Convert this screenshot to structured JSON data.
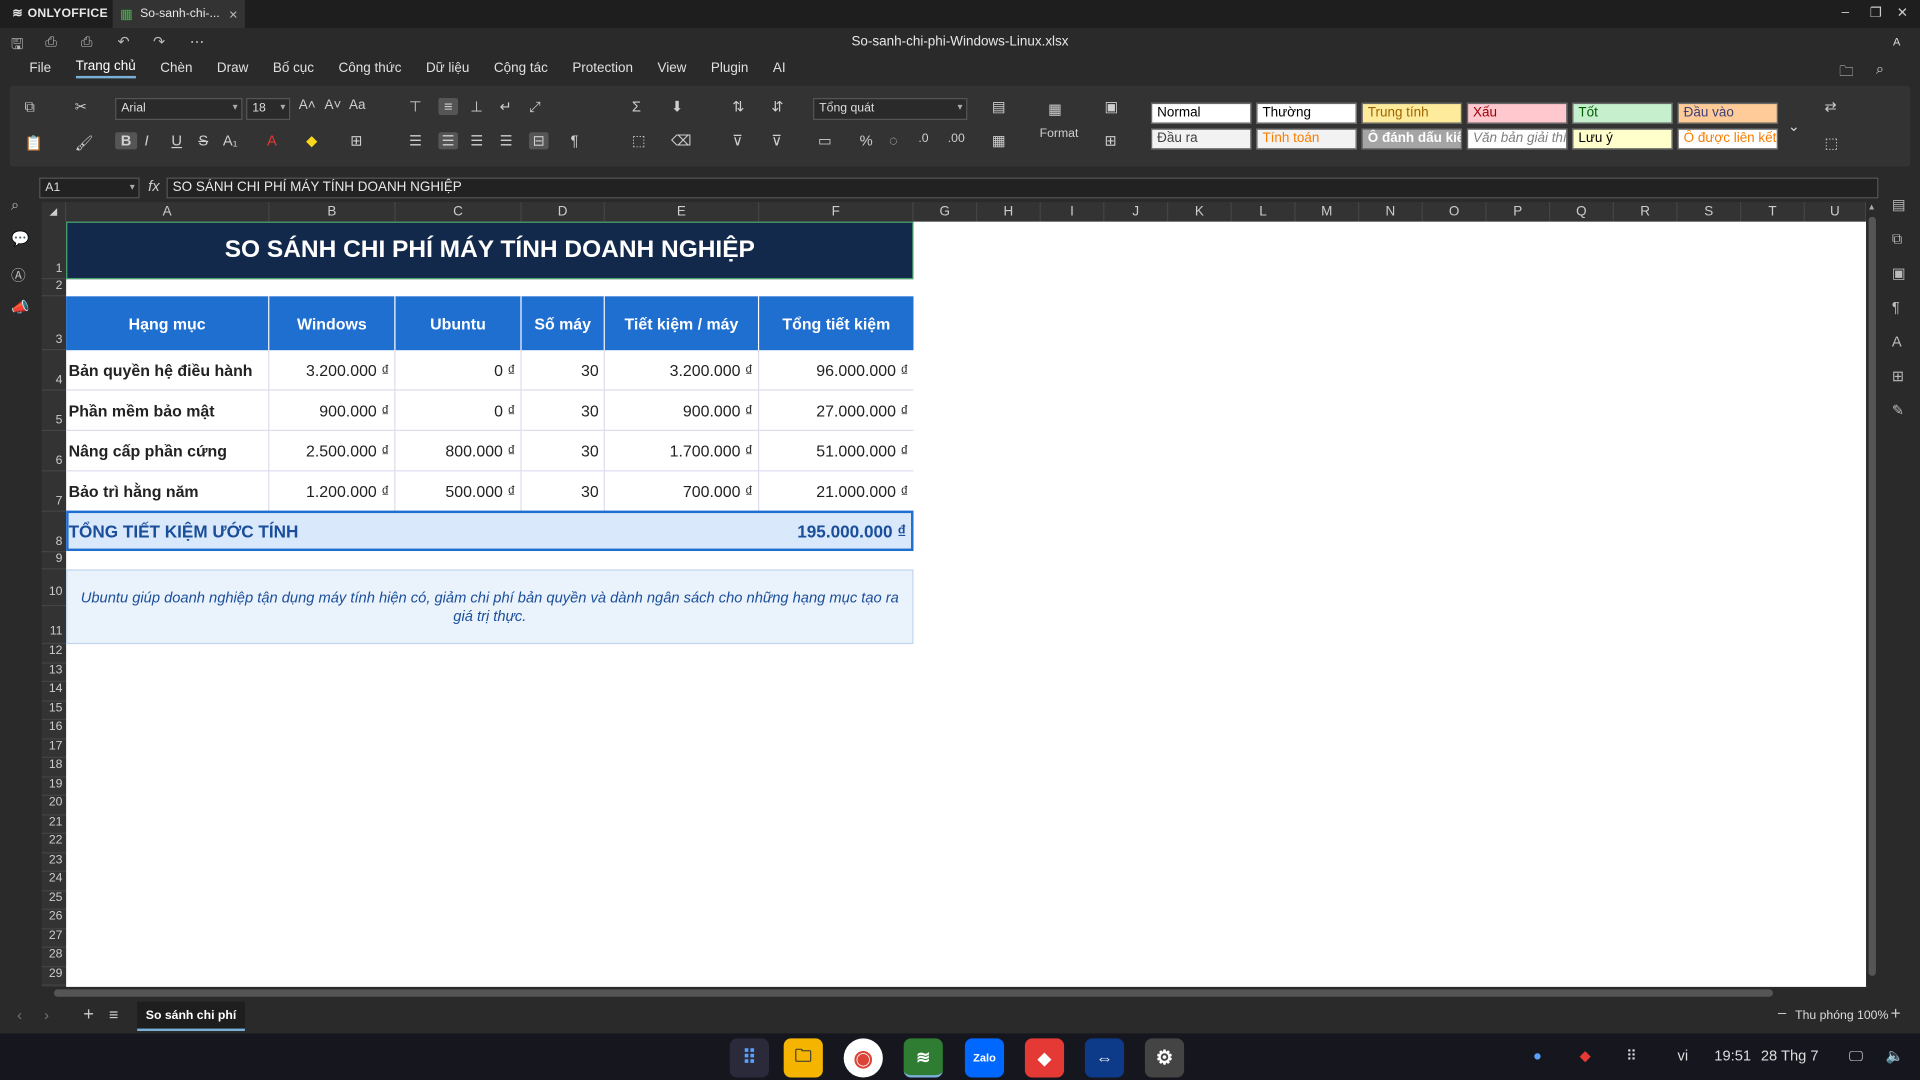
{
  "app": {
    "brand": "ONLYOFFICE",
    "tab_title": "So-sanh-chi-...",
    "file_name": "So-sanh-chi-phi-Windows-Linux.xlsx",
    "user_initial": "A"
  },
  "menu": [
    "File",
    "Trang chủ",
    "Chèn",
    "Draw",
    "Bố cục",
    "Công thức",
    "Dữ liệu",
    "Cộng tác",
    "Protection",
    "View",
    "Plugin",
    "AI"
  ],
  "menu_active": "Trang chủ",
  "ribbon": {
    "font_name": "Arial",
    "font_size": "18",
    "number_format": "Tổng quát",
    "format_label": "Format",
    "styles": [
      {
        "label": "Normal",
        "bg": "#ffffff",
        "fg": "#000000"
      },
      {
        "label": "Thường",
        "bg": "#ffffff",
        "fg": "#000000"
      },
      {
        "label": "Trung tính",
        "bg": "#ffeb9c",
        "fg": "#9c6500"
      },
      {
        "label": "Xấu",
        "bg": "#ffc7ce",
        "fg": "#9c0006"
      },
      {
        "label": "Tốt",
        "bg": "#c6efce",
        "fg": "#006100"
      },
      {
        "label": "Đầu vào",
        "bg": "#ffcc99",
        "fg": "#3f3f76"
      },
      {
        "label": "Đầu ra",
        "bg": "#f2f2f2",
        "fg": "#3f3f3f"
      },
      {
        "label": "Tính toán",
        "bg": "#f2f2f2",
        "fg": "#fa7d00"
      },
      {
        "label": "Ô đánh dấu kiể",
        "bg": "#a5a5a5",
        "fg": "#ffffff"
      },
      {
        "label": "Văn bản giải thí",
        "bg": "#ffffff",
        "fg": "#7f7f7f"
      },
      {
        "label": "Lưu ý",
        "bg": "#ffffcc",
        "fg": "#000000"
      },
      {
        "label": "Ô được liên kết",
        "bg": "#ffffff",
        "fg": "#fa7d00"
      }
    ]
  },
  "formula_bar": {
    "cell_ref": "A1",
    "fx": "fx",
    "content": "SO SÁNH CHI PHÍ MÁY TÍNH DOANH NGHIỆP"
  },
  "columns": [
    "A",
    "B",
    "C",
    "D",
    "E",
    "F",
    "G",
    "H",
    "I",
    "J",
    "K",
    "L",
    "M",
    "N",
    "O",
    "P",
    "Q",
    "R",
    "S",
    "T",
    "U"
  ],
  "rows": [
    "1",
    "2",
    "3",
    "4",
    "5",
    "6",
    "7",
    "8",
    "9",
    "10",
    "11",
    "12",
    "13",
    "14",
    "15",
    "16",
    "17",
    "18",
    "19",
    "20",
    "21",
    "22",
    "23",
    "24",
    "25",
    "26",
    "27",
    "28",
    "29"
  ],
  "sheet": {
    "title": "SO SÁNH CHI PHÍ MÁY TÍNH DOANH NGHIỆP",
    "headers": [
      "Hạng mục",
      "Windows",
      "Ubuntu",
      "Số máy",
      "Tiết kiệm / máy",
      "Tổng tiết kiệm"
    ],
    "rows": [
      [
        "Bản quyền hệ điều hành",
        "3.200.000 ₫",
        "0 ₫",
        "30",
        "3.200.000 ₫",
        "96.000.000 ₫"
      ],
      [
        "Phần mềm bảo mật",
        "900.000 ₫",
        "0 ₫",
        "30",
        "900.000 ₫",
        "27.000.000 ₫"
      ],
      [
        "Nâng cấp phần cứng",
        "2.500.000 ₫",
        "800.000 ₫",
        "30",
        "1.700.000 ₫",
        "51.000.000 ₫"
      ],
      [
        "Bảo trì hằng năm",
        "1.200.000 ₫",
        "500.000 ₫",
        "30",
        "700.000 ₫",
        "21.000.000 ₫"
      ]
    ],
    "total_label": "TỔNG TIẾT KIỆM ƯỚC TÍNH",
    "total_value": "195.000.000 ₫",
    "note": "Ubuntu giúp doanh nghiệp tận dụng máy tính hiện có, giảm chi phí bản quyền và dành ngân sách cho những hạng mục tạo ra giá trị thực.",
    "colors": {
      "title_bg": "#13294b",
      "header_bg": "#1f6fd1",
      "total_bg": "#d9e8fb",
      "total_fg": "#1a4e9a",
      "note_bg": "#eaf2fc",
      "note_fg": "#1a4e9a"
    }
  },
  "sheet_tab": "So sánh chi phí",
  "status": {
    "zoom": "Thu phóng 100%"
  },
  "taskbar": {
    "apps": [
      "apps-grid",
      "files",
      "chrome",
      "onlyoffice",
      "Zalo",
      "anydesk",
      "teamviewer",
      "settings"
    ],
    "lang": "vi",
    "time": "19:51",
    "date": "28 Thg 7"
  }
}
